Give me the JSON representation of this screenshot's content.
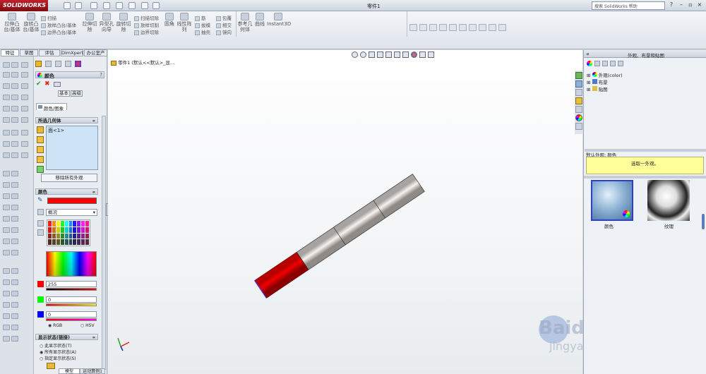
{
  "app": {
    "logo": "SOLIDWORKS",
    "doc_title": "零件1",
    "search_placeholder": "搜索 SolidWorks 帮助"
  },
  "toolbar": {
    "extrude_boss": "拉伸凸台/基体",
    "revolve_boss": "旋转凸台/基体",
    "sweep": "扫描",
    "loft_boss": "放样凸台/基体",
    "boundary_boss": "边界凸台/基体",
    "extrude_cut": "拉伸切除",
    "hole_wizard": "异型孔向导",
    "revolve_cut": "旋转切除",
    "swept_cut": "扫描切除",
    "lofted_cut": "放样切割",
    "boundary_cut": "边界切除",
    "fillet": "圆角",
    "linear_pattern": "线性阵列",
    "rib": "筋",
    "draft": "拔模",
    "shell": "抽壳",
    "wrap": "包覆",
    "intersect": "相交",
    "mirror": "镜向",
    "ref_geometry": "参考几何体",
    "curves": "曲线",
    "instant3d": "Instant3D"
  },
  "tabs": [
    "特征",
    "草图",
    "评估",
    "DimXpert",
    "办公室产品"
  ],
  "property_manager": {
    "title": "颜色",
    "mode_basic": "基本",
    "mode_advanced": "高级",
    "tab_color": "颜色/图象",
    "selected_geometry": {
      "header": "所选几何体",
      "items": [
        "面<1>"
      ],
      "remove_button": "移除所有外观"
    },
    "color": {
      "header": "颜色",
      "dropdown": "概况",
      "r": "255",
      "g": "0",
      "b": "0",
      "mode_rgb": "RGB",
      "mode_hsv": "HSV",
      "swatch": "#ff0000"
    },
    "display_states": {
      "header": "显示状态(链接)",
      "options": [
        "此显示状态(T)",
        "所有显示状态(A)",
        "指定显示状态(S)"
      ]
    }
  },
  "viewport": {
    "tree_label": "零件1 (默认<<默认>_显..."
  },
  "right_panel": {
    "title": "外观、布景和贴图",
    "tree": [
      "外观(color)",
      "布景",
      "贴图"
    ],
    "default_appearance_label": "默认外观: 颜色",
    "hint": "选取一外观。",
    "thumbs": [
      "颜色",
      "纹理"
    ]
  },
  "bottom_tabs": [
    "模型",
    "运动算例1"
  ],
  "watermark": {
    "brand": "Baidu经验",
    "url": "jingyan.baidu.com"
  },
  "colors": {
    "accent": "#ff0000",
    "hint_bg": "#ffff99"
  }
}
